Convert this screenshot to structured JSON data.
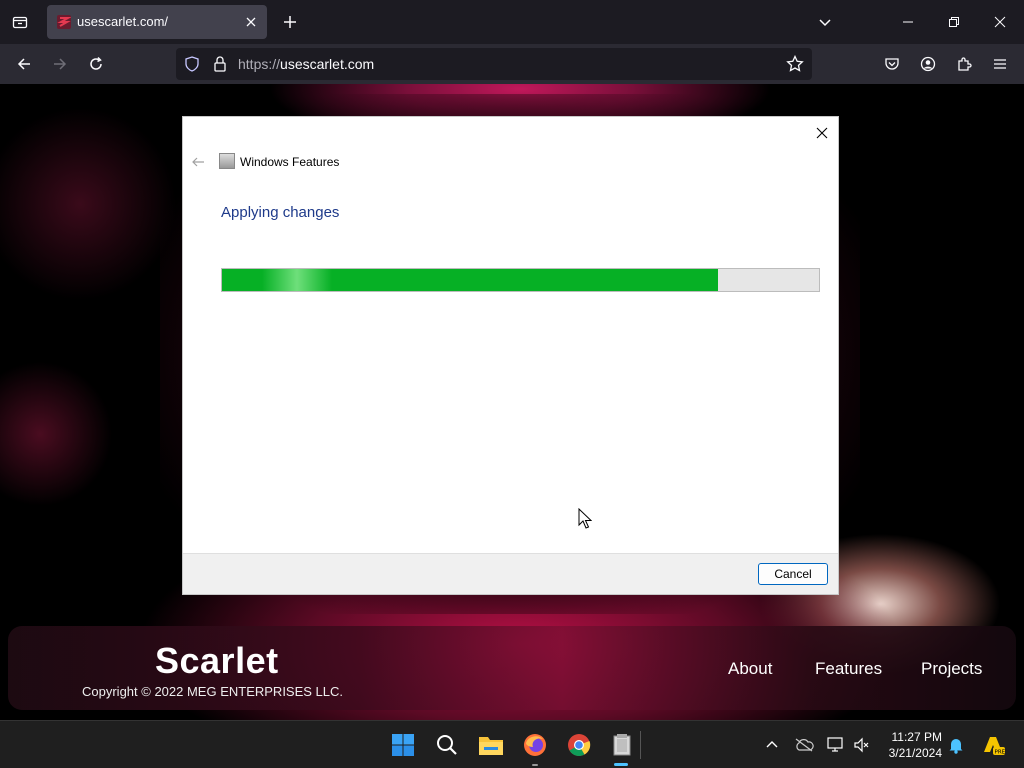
{
  "browser": {
    "tab_title": "usescarlet.com/",
    "url_protocol": "https://",
    "url_host": "usescarlet.com"
  },
  "site": {
    "brand": "Scarlet",
    "copyright": "Copyright © 2022 MEG ENTERPRISES LLC.",
    "nav": [
      "About",
      "Features",
      "Projects"
    ]
  },
  "dialog": {
    "title": "Windows Features",
    "heading": "Applying changes",
    "progress_percent": 83,
    "cancel_label": "Cancel"
  },
  "taskbar": {
    "time": "11:27 PM",
    "date": "3/21/2024"
  },
  "colors": {
    "progress_fill": "#06b025",
    "heading": "#1e3a8a",
    "accent": "#0067c0"
  }
}
